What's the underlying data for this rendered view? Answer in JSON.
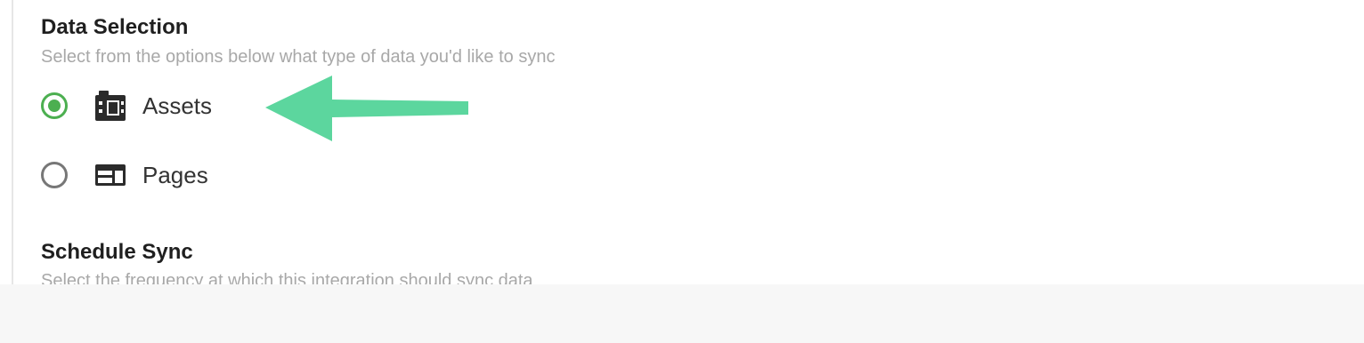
{
  "data_selection": {
    "title": "Data Selection",
    "subtitle": "Select from the options below what type of data you'd like to sync",
    "options": [
      {
        "label": "Assets",
        "icon": "film-strip-icon",
        "selected": true
      },
      {
        "label": "Pages",
        "icon": "page-layout-icon",
        "selected": false
      }
    ]
  },
  "schedule_sync": {
    "title": "Schedule Sync",
    "subtitle": "Select the frequency at which this integration should sync data"
  },
  "colors": {
    "accent": "#4caf50",
    "arrow": "#5cd69e",
    "title": "#1f1f1f",
    "subtitle": "#a8a8a8"
  }
}
